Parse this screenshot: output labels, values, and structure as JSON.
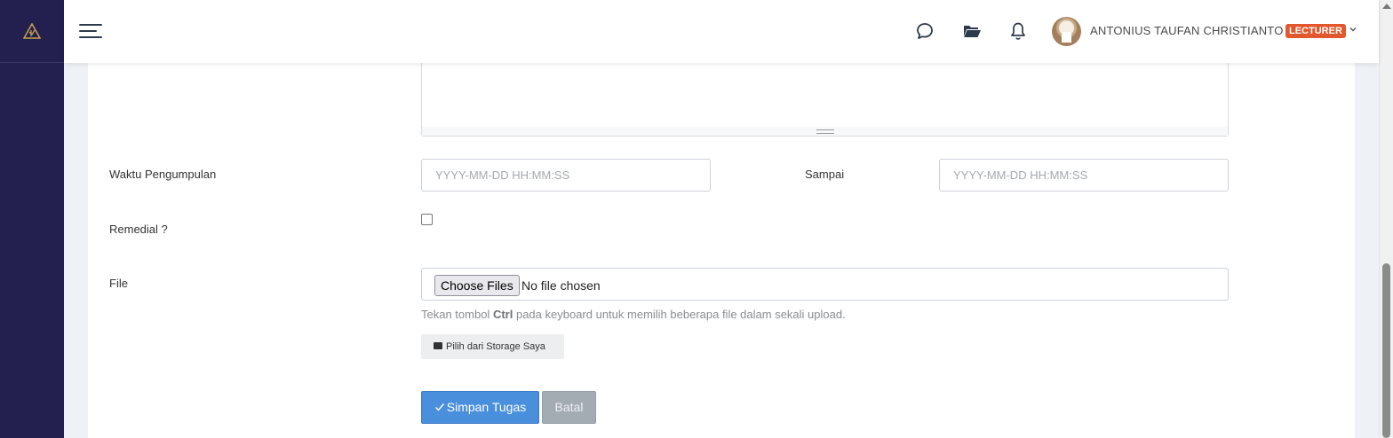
{
  "header": {
    "user_name": "ANTONIUS TAUFAN CHRISTIANTO",
    "role_badge": "LECTURER",
    "icons": [
      "menu-icon",
      "chat-icon",
      "folder-icon",
      "bell-icon",
      "chevron-down-icon"
    ]
  },
  "form": {
    "submission_time": {
      "label": "Waktu Pengumpulan",
      "placeholder": "YYYY-MM-DD HH:MM:SS",
      "until_label": "Sampai",
      "until_placeholder": "YYYY-MM-DD HH:MM:SS"
    },
    "remedial": {
      "label": "Remedial ?",
      "checked": false
    },
    "file": {
      "label": "File",
      "choose_button": "Choose Files",
      "status": "No file chosen",
      "help_prefix": "Tekan tombol",
      "help_key": "Ctrl",
      "help_suffix": "pada keyboard untuk memilih beberapa file dalam sekali upload.",
      "storage_button": "Pilih dari Storage Saya"
    },
    "actions": {
      "save": "Simpan Tugas",
      "cancel": "Batal"
    }
  },
  "colors": {
    "sidebar": "#23204f",
    "logo_accent": "#c9a24a",
    "badge": "#e2572c",
    "primary": "#4a8fdc",
    "cancel": "#a3abb3"
  }
}
